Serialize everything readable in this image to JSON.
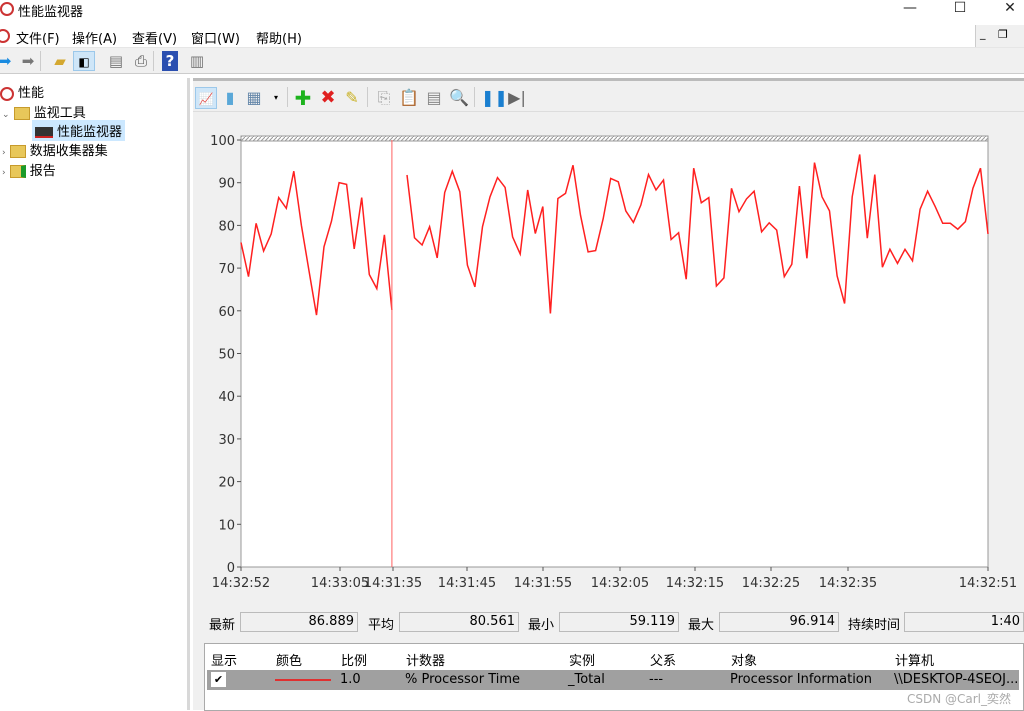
{
  "window": {
    "title": "性能监视器",
    "controls": [
      "minimize",
      "maximize",
      "close"
    ]
  },
  "menu": [
    "文件(F)",
    "操作(A)",
    "查看(V)",
    "窗口(W)",
    "帮助(H)"
  ],
  "toolbar_icons": [
    "back-arrow-icon",
    "forward-arrow-icon",
    "up-folder-icon",
    "show-hide-tree-icon",
    "properties-icon",
    "print-icon",
    "help-icon",
    "show-hide-action-pane-icon"
  ],
  "tree": {
    "root": "性能",
    "items": [
      {
        "label": "监视工具",
        "children": [
          "性能监视器"
        ]
      },
      {
        "label": "数据收集器集"
      },
      {
        "label": "报告"
      }
    ],
    "selected": "性能监视器"
  },
  "inner_toolbar_icons": [
    "view-graph-icon",
    "view-histogram-icon",
    "view-report-icon",
    "dropdown-icon",
    "add-counter-icon",
    "delete-counter-icon",
    "highlight-icon",
    "copy-properties-icon",
    "paste-counter-icon",
    "properties-icon",
    "zoom-icon",
    "freeze-display-icon",
    "update-data-icon"
  ],
  "stats": {
    "last_label": "最新",
    "last": "86.889",
    "avg_label": "平均",
    "avg": "80.561",
    "min_label": "最小",
    "min": "59.119",
    "max_label": "最大",
    "max": "96.914",
    "duration_label": "持续时间",
    "duration": "1:40"
  },
  "legend": {
    "headers": [
      "显示",
      "颜色",
      "比例",
      "计数器",
      "实例",
      "父系",
      "对象",
      "计算机"
    ],
    "rows": [
      {
        "show": true,
        "color": "#ff2020",
        "scale": "1.0",
        "counter": "% Processor Time",
        "instance": "_Total",
        "parent": "---",
        "object": "Processor Information",
        "computer": "\\\\DESKTOP-4SEOJ..."
      }
    ]
  },
  "watermark": "CSDN @Carl_奕然",
  "chart_data": {
    "type": "line",
    "ylim": [
      0,
      100
    ],
    "yticks": [
      0,
      10,
      20,
      30,
      40,
      50,
      60,
      70,
      80,
      90,
      100
    ],
    "xtick_labels": [
      "14:32:52",
      "14:33:05",
      "14:31:35",
      "14:31:45",
      "14:31:55",
      "14:32:05",
      "14:32:15",
      "14:32:25",
      "14:32:35",
      "14:32:51"
    ],
    "line_color": "#ff2020",
    "cursor_color": "#ff6060",
    "series": [
      {
        "values": [
          76,
          68,
          80.5,
          74,
          78,
          86.5,
          84,
          92.7,
          80,
          69.5,
          59,
          75,
          81,
          90,
          89.6,
          74.5,
          86.5,
          68.5,
          65.2,
          77.8,
          60.2,
          null,
          91.8,
          77.1,
          75.4,
          79.7,
          72.4,
          87.7,
          92.7,
          87.9,
          70.7,
          65.6,
          79.7,
          86.7,
          91.2,
          88.9,
          77.3,
          73.3,
          88.3,
          78.1,
          84.4,
          59.4,
          86.3,
          87.5,
          94.1,
          82.4,
          73.8,
          74.1,
          81.6,
          91,
          90.2,
          83.4,
          80.7,
          84.8,
          91.9,
          88.3,
          90.6,
          76.7,
          78.3,
          67.4,
          93.4,
          85.3,
          86.5,
          65.8,
          67.7,
          88.7,
          83.2,
          86.2,
          88,
          78.5,
          80.6,
          78.9,
          68,
          70.9,
          89.2,
          72.3,
          94.7,
          86.7,
          83.4,
          68.2,
          61.7,
          86.7,
          96.6,
          77,
          91.9,
          70.2,
          74.4,
          71.1,
          74.4,
          71.7,
          83.8,
          88,
          84.4,
          80.5,
          80.5,
          79.1,
          80.9,
          88.7,
          93.4,
          78
        ]
      }
    ]
  }
}
